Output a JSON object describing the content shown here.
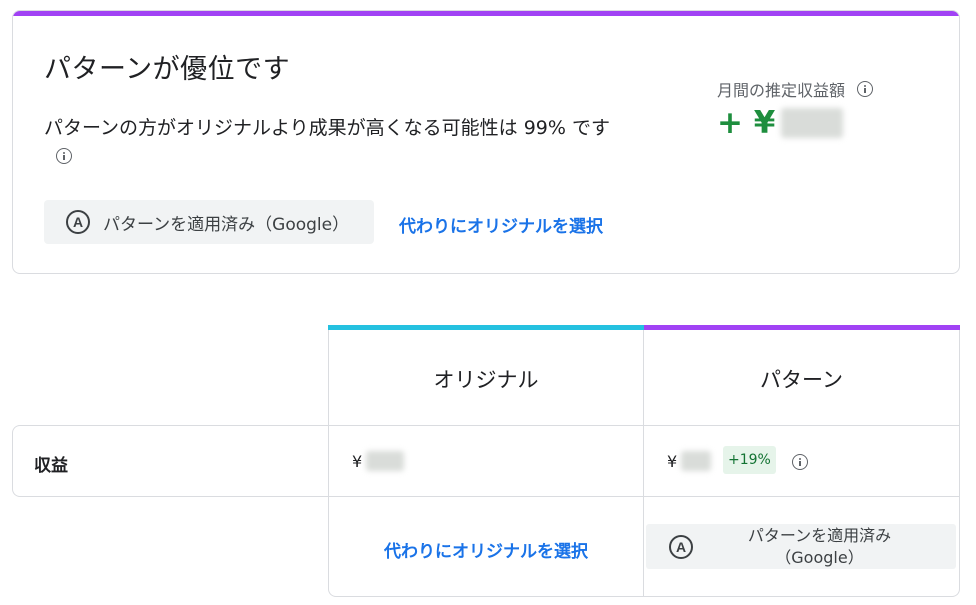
{
  "summary": {
    "title": "パターンが優位です",
    "description": "パターンの方がオリジナルより成果が高くなる可能性は 99% です",
    "applied_label": "パターンを適用済み（Google）",
    "choose_original_label": "代わりにオリジナルを選択",
    "earnings_label": "月間の推定収益額",
    "earnings_prefix": "+ ¥"
  },
  "table": {
    "columns": [
      {
        "label": "オリジナル",
        "color": "#24c1e0"
      },
      {
        "label": "パターン",
        "color": "#a142f4"
      }
    ],
    "row_label": "収益",
    "original_value_prefix": "¥",
    "pattern_value_prefix": "¥",
    "pattern_delta": "+19%",
    "choose_original_label": "代わりにオリジナルを選択",
    "applied_line1": "パターンを適用済み",
    "applied_line2": "（Google）"
  },
  "icons": {
    "auto_applied": "A",
    "info": "info-icon"
  },
  "colors": {
    "accent_purple": "#a142f4",
    "accent_cyan": "#24c1e0",
    "link_blue": "#1a73e8",
    "positive_green": "#1e8e3e"
  }
}
